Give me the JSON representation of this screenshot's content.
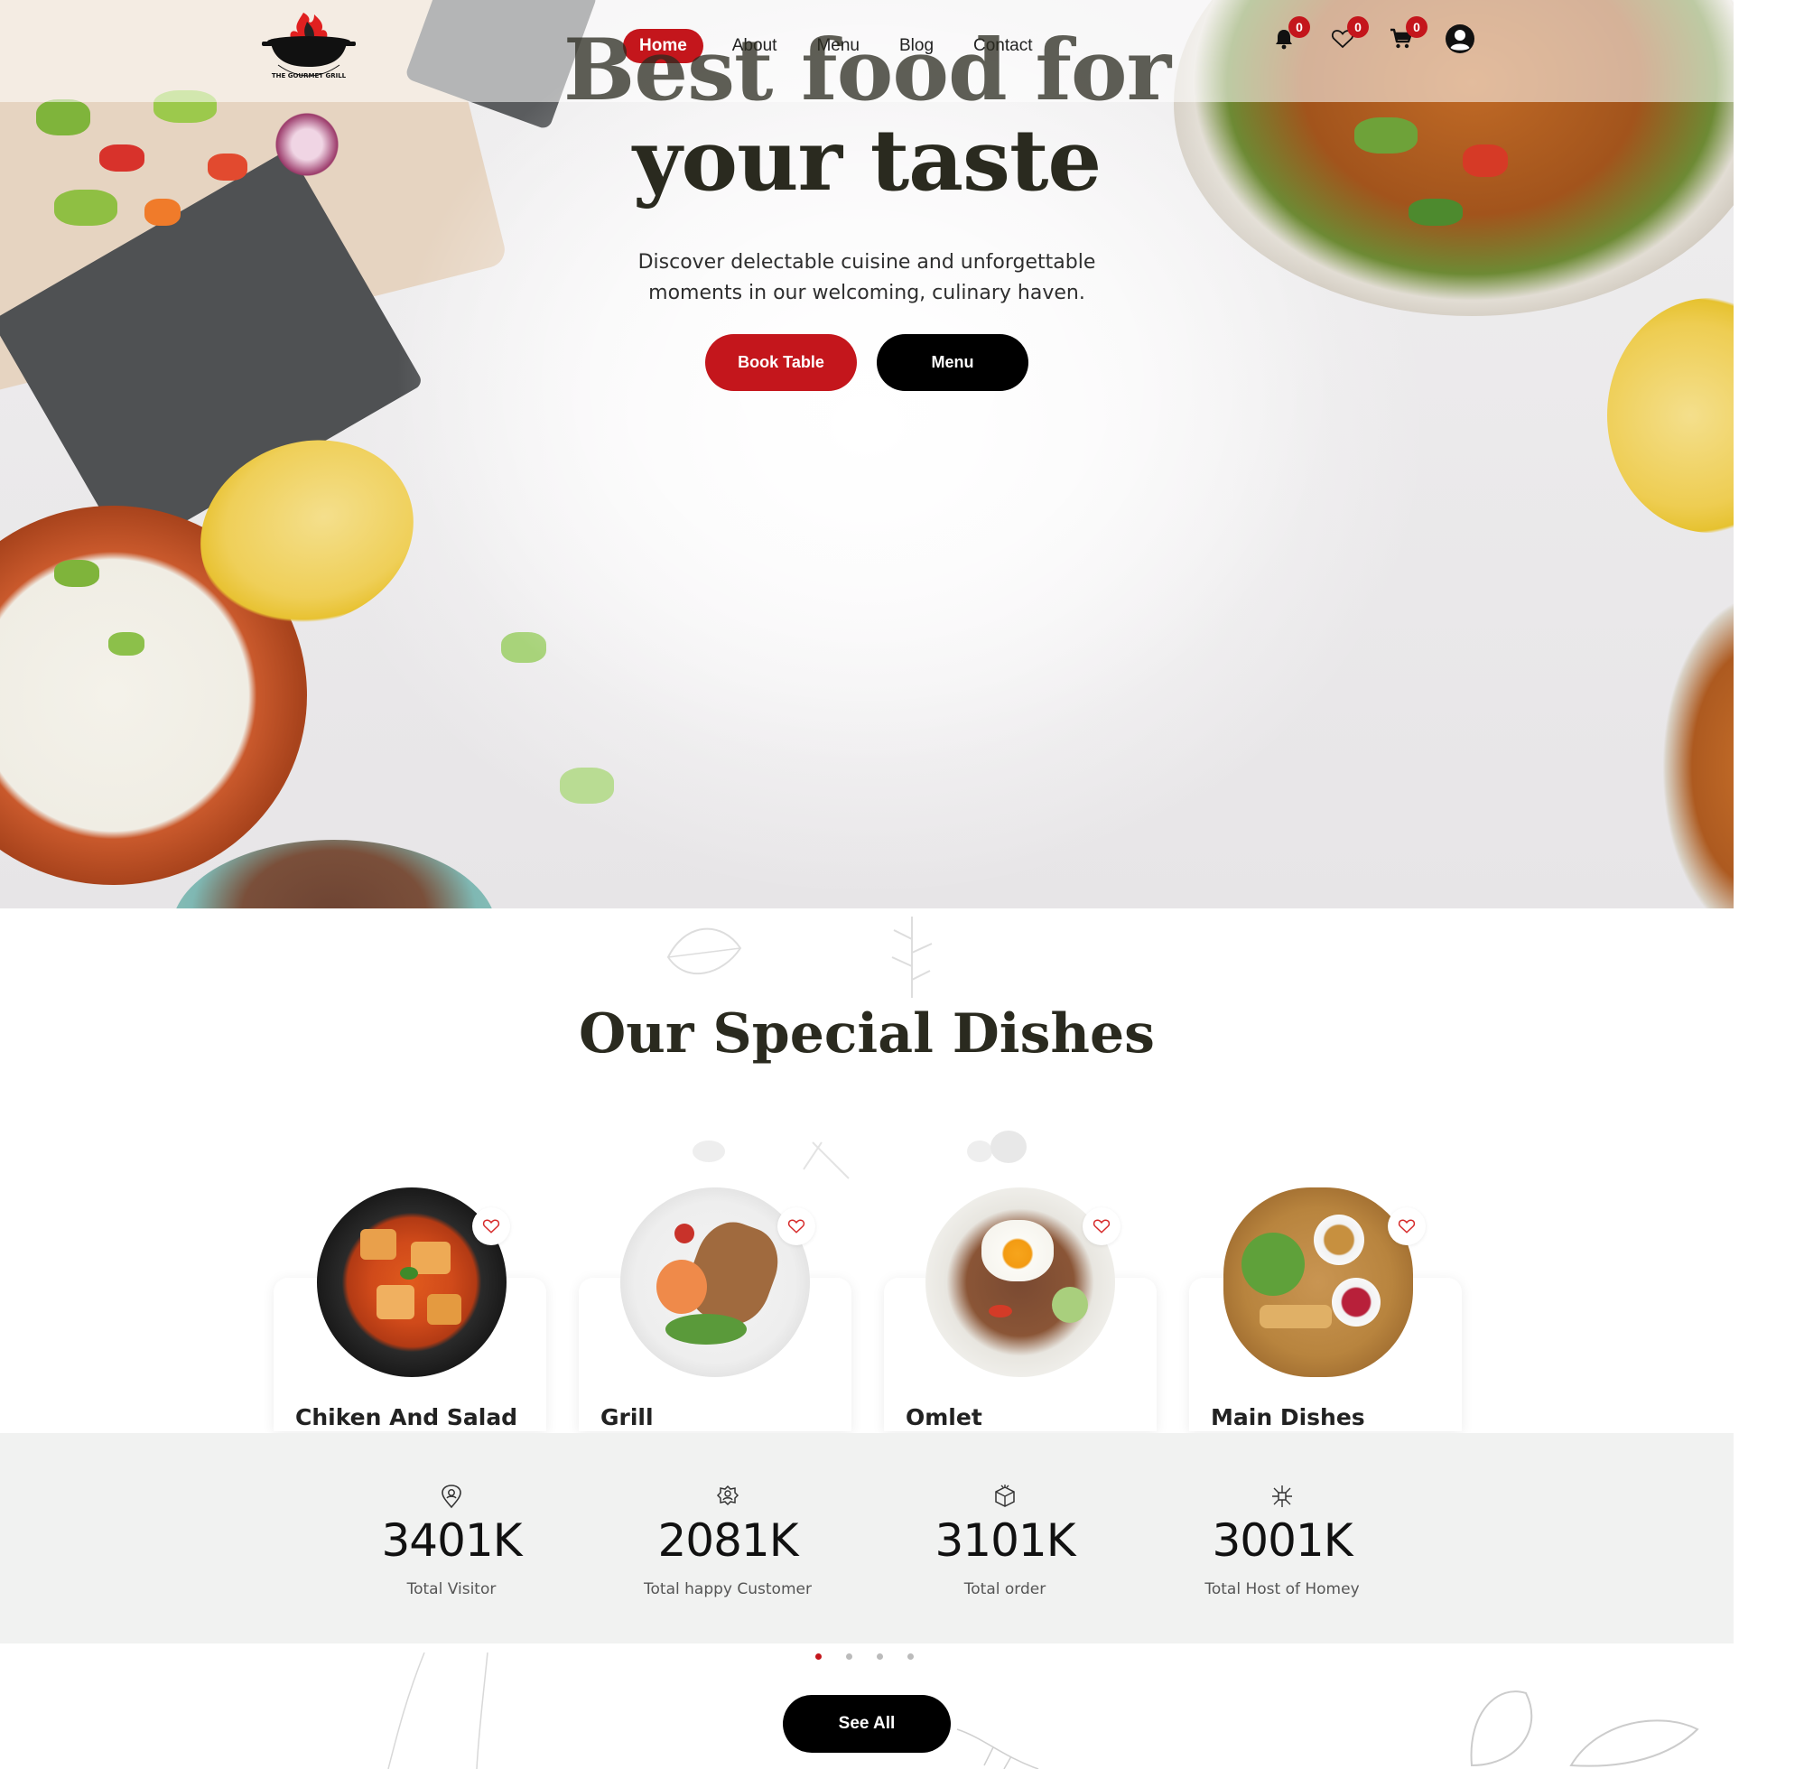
{
  "brand": {
    "logo_text": "THE GOURMET GRILL"
  },
  "nav": {
    "links": [
      {
        "label": "Home",
        "active": true
      },
      {
        "label": "About"
      },
      {
        "label": "Menu"
      },
      {
        "label": "Blog"
      },
      {
        "label": "Contact"
      }
    ],
    "icons": [
      {
        "name": "bell-icon",
        "badge": "0"
      },
      {
        "name": "heart-icon",
        "badge": "0"
      },
      {
        "name": "cart-icon",
        "badge": "0"
      },
      {
        "name": "user-avatar-icon"
      }
    ]
  },
  "hero": {
    "title_line1": "Best food for",
    "title_line2": "your taste",
    "subtitle_line1": "Discover delectable cuisine and unforgettable",
    "subtitle_line2": "moments in our welcoming, culinary haven.",
    "book_button": "Book Table",
    "menu_button": "Menu"
  },
  "specials": {
    "title": "Our Special Dishes",
    "dishes": [
      {
        "name": "Chiken And Salad"
      },
      {
        "name": "Grill"
      },
      {
        "name": "Omlet"
      },
      {
        "name": "Main Dishes"
      }
    ],
    "see_all": "See All"
  },
  "stats": [
    {
      "icon": "location-pin-icon",
      "value": "3401K",
      "label": "Total Visitor"
    },
    {
      "icon": "happy-customer-icon",
      "value": "2081K",
      "label": "Total happy Customer"
    },
    {
      "icon": "order-box-icon",
      "value": "3101K",
      "label": "Total order"
    },
    {
      "icon": "host-network-icon",
      "value": "3001K",
      "label": "Total Host of Homey"
    }
  ],
  "carousel": {
    "pages": 4,
    "active": 0
  },
  "colors": {
    "accent": "#c4161c",
    "dark": "#000000",
    "heading": "#2a2a1f",
    "stats_bg": "#f1f2f1"
  }
}
